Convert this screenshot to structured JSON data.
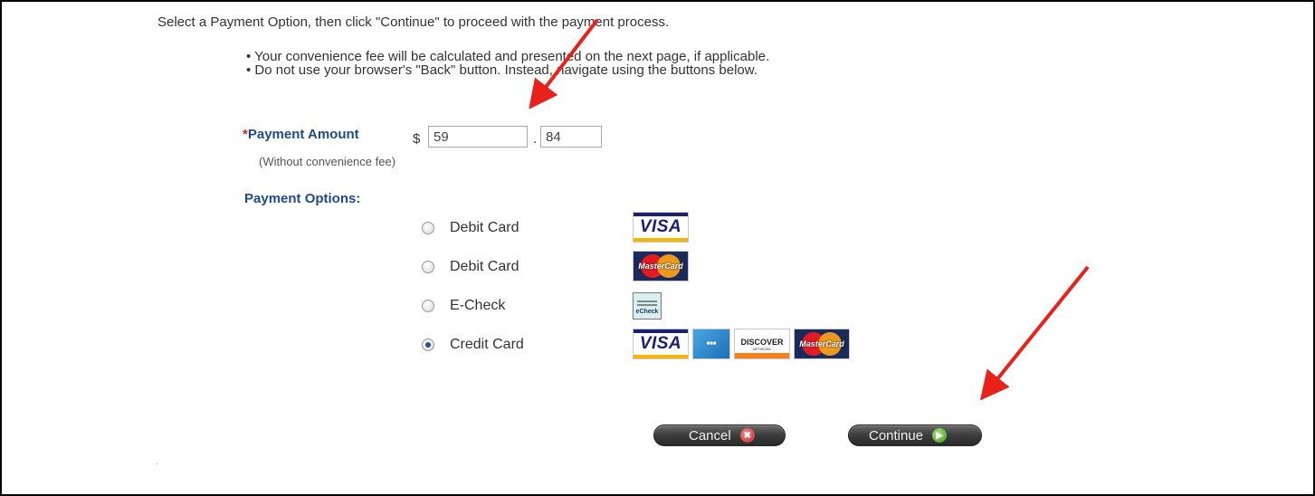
{
  "instructions": {
    "intro": "Select a Payment Option, then click \"Continue\" to proceed with the payment process.",
    "bullets": [
      "• Your convenience fee will be calculated and presented on the next page, if applicable.",
      "• Do not use your browser's \"Back\" button. Instead, navigate using the buttons below."
    ]
  },
  "payment_amount": {
    "required_marker": "*",
    "label": "Payment Amount",
    "currency": "$",
    "dollars": "59",
    "separator": ".",
    "cents": "84",
    "note": "(Without convenience fee)"
  },
  "payment_options": {
    "heading": "Payment Options:",
    "options": [
      {
        "label": "Debit Card",
        "selected": false,
        "logos": [
          "visa-logo"
        ]
      },
      {
        "label": "Debit Card",
        "selected": false,
        "logos": [
          "mastercard-logo"
        ]
      },
      {
        "label": "E-Check",
        "selected": false,
        "logos": [
          "echeck-logo"
        ]
      },
      {
        "label": "Credit Card",
        "selected": true,
        "logos": [
          "visa-logo",
          "amex-logo",
          "discover-logo",
          "mastercard-logo"
        ]
      }
    ],
    "logo_text": {
      "visa": "VISA",
      "mastercard": "MasterCard",
      "discover": "DISCOVER",
      "discover_sub": "NETWORK",
      "echeck": "eCheck"
    }
  },
  "buttons": {
    "cancel_label": "Cancel",
    "cancel_icon": "close-icon",
    "continue_label": "Continue",
    "continue_icon": "arrow-right-icon"
  },
  "colors": {
    "heading_blue": "#1f4b8c",
    "required_red": "#e2231a",
    "annotation_arrow": "#e8221b"
  }
}
